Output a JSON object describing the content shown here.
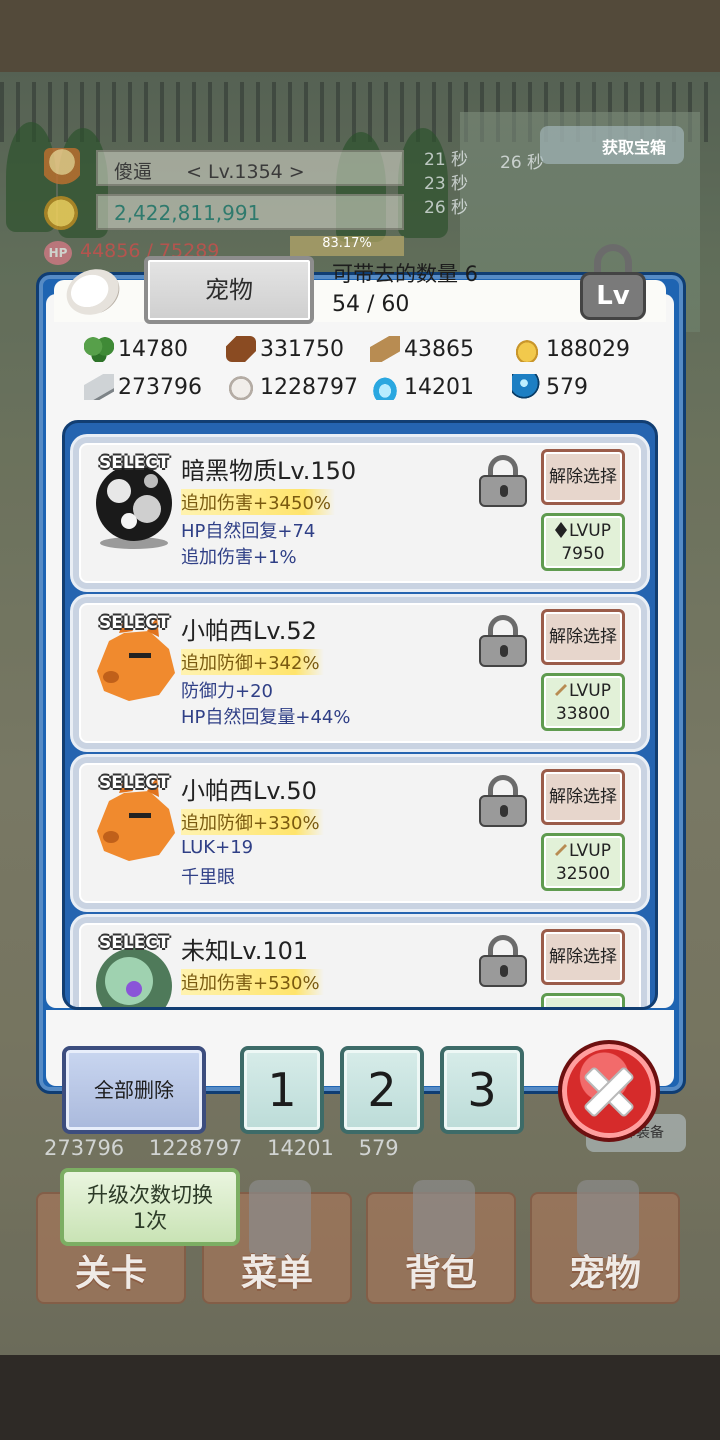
{
  "hud": {
    "player_name": "傻逼",
    "player_level": "< Lv.1354 >",
    "gold": "2,422,811,991",
    "timer_1": "21 秒",
    "timer_1b": "26 秒",
    "timer_2": "23 秒",
    "timer_3": "26 秒",
    "hp": "44856 / 75289",
    "exp_percent": "83.17%",
    "get_treasure": "获取宝箱"
  },
  "panel": {
    "title": "宠物",
    "carry_label": "可带去的数量 6",
    "carry_count": "54 / 60",
    "lv_icon_label": "Lv"
  },
  "resources": [
    {
      "icon": "leaf-icon",
      "value": "14780"
    },
    {
      "icon": "wood-icon",
      "value": "331750"
    },
    {
      "icon": "plank-icon",
      "value": "43865"
    },
    {
      "icon": "drop-icon",
      "value": "188029"
    },
    {
      "icon": "iron-icon",
      "value": "273796"
    },
    {
      "icon": "stone-icon",
      "value": "1228797"
    },
    {
      "icon": "fire-icon",
      "value": "14201"
    },
    {
      "icon": "orb-icon",
      "value": "579"
    }
  ],
  "pets": [
    {
      "select": "SELECT",
      "name": "暗黑物质Lv.150",
      "stat1": "追加伤害+3450%",
      "stat2": "HP自然回复+74",
      "stat3": "追加伤害+1%",
      "deselect": "解除选择",
      "lvup": "LVUP",
      "cost": "7950",
      "cost_icon": "dark-gem-icon"
    },
    {
      "select": "SELECT",
      "name": "小帕西Lv.52",
      "stat1": "追加防御+342%",
      "stat2": "防御力+20",
      "stat3": "HP自然回复量+44%",
      "deselect": "解除选择",
      "lvup": "LVUP",
      "cost": "33800",
      "cost_icon": "plank-icon"
    },
    {
      "select": "SELECT",
      "name": "小帕西Lv.50",
      "stat1": "追加防御+330%",
      "stat2": "LUK+19",
      "stat3": "千里眼",
      "deselect": "解除选择",
      "lvup": "LVUP",
      "cost": "32500",
      "cost_icon": "plank-icon"
    },
    {
      "select": "SELECT",
      "name": "未知Lv.101",
      "stat1": "追加伤害+530%",
      "stat2": "",
      "stat3": "",
      "deselect": "解除选择",
      "lvup": "",
      "cost": "",
      "cost_icon": ""
    }
  ],
  "footer": {
    "delete_all": "全部删除",
    "slot_1": "1",
    "slot_2": "2",
    "slot_3": "3"
  },
  "scene": {
    "res_1": "273796",
    "res_2": "1228797",
    "res_3": "14201",
    "res_4": "579",
    "equip_all": "全部装备",
    "switch_label_1": "升级次数切换",
    "switch_label_2": "1次",
    "nav": [
      "关卡",
      "菜单",
      "背包",
      "宠物"
    ]
  },
  "colors": {
    "panel_blue": "#1e64b2",
    "stat_highlight": "#ffe46c",
    "close_red": "#d62b2b"
  }
}
